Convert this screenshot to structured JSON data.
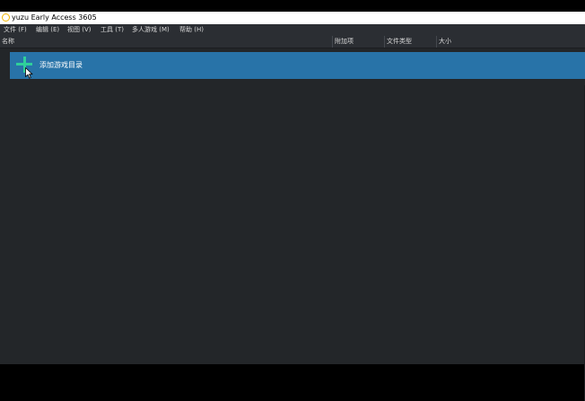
{
  "window": {
    "title": "yuzu Early Access 3605",
    "app_icon": "yuzu-logo-icon"
  },
  "menubar": {
    "items": [
      {
        "label": "文件 (F)"
      },
      {
        "label": "编辑 (E)"
      },
      {
        "label": "视图 (V)"
      },
      {
        "label": "工具 (T)"
      },
      {
        "label": "多人游戏 (M)"
      },
      {
        "label": "帮助 (H)"
      }
    ]
  },
  "game_list": {
    "columns": [
      {
        "label": "名称"
      },
      {
        "label": "附加项"
      },
      {
        "label": "文件类型"
      },
      {
        "label": "大小"
      }
    ],
    "add_directory": {
      "label": "添加游戏目录",
      "icon": "plus-icon"
    }
  },
  "colors": {
    "background": "#232629",
    "selection": "#2873a8",
    "accent": "#2fcf9a"
  }
}
